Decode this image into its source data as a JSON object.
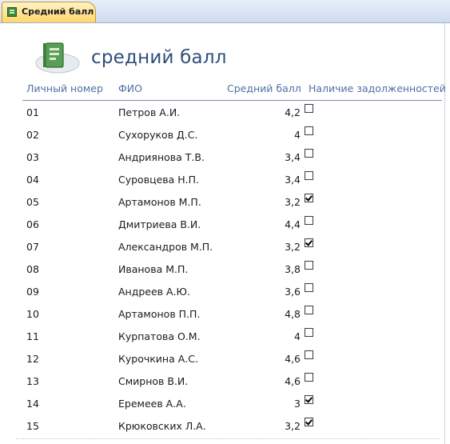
{
  "tab": {
    "label": "Средний балл"
  },
  "report": {
    "title": "средний балл"
  },
  "columns": {
    "id": "Личный номер",
    "name": "ФИО",
    "avg": "Средний балл",
    "debt": "Наличие задолженностей"
  },
  "rows": [
    {
      "id": "01",
      "name": "Петров А.И.",
      "avg": "4,2",
      "debt": false
    },
    {
      "id": "02",
      "name": "Сухоруков Д.С.",
      "avg": "4",
      "debt": false
    },
    {
      "id": "03",
      "name": "Андриянова Т.В.",
      "avg": "3,4",
      "debt": false
    },
    {
      "id": "04",
      "name": "Суровцева Н.П.",
      "avg": "3,4",
      "debt": false
    },
    {
      "id": "05",
      "name": "Артамонов М.П.",
      "avg": "3,2",
      "debt": true
    },
    {
      "id": "06",
      "name": "Дмитриева В.И.",
      "avg": "4,4",
      "debt": false
    },
    {
      "id": "07",
      "name": "Александров М.П.",
      "avg": "3,2",
      "debt": true
    },
    {
      "id": "08",
      "name": "Иванова М.П.",
      "avg": "3,8",
      "debt": false
    },
    {
      "id": "09",
      "name": "Андреев А.Ю.",
      "avg": "3,6",
      "debt": false
    },
    {
      "id": "10",
      "name": "Артамонов П.П.",
      "avg": "4,8",
      "debt": false
    },
    {
      "id": "11",
      "name": "Курпатова О.М.",
      "avg": "4",
      "debt": false
    },
    {
      "id": "12",
      "name": "Курочкина А.С.",
      "avg": "4,6",
      "debt": false
    },
    {
      "id": "13",
      "name": "Смирнов В.И.",
      "avg": "4,6",
      "debt": false
    },
    {
      "id": "14",
      "name": "Еремеев А.А.",
      "avg": "3",
      "debt": true
    },
    {
      "id": "15",
      "name": "Крюковских Л.А.",
      "avg": "3,2",
      "debt": true
    }
  ]
}
